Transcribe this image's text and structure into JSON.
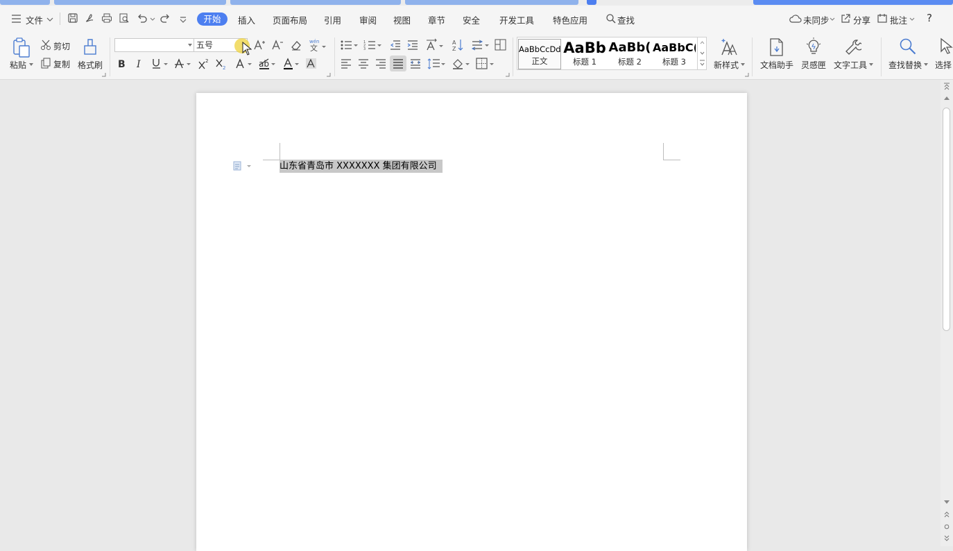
{
  "menubar": {
    "file_label": "文件",
    "tabs": [
      {
        "label": "开始",
        "active": true
      },
      {
        "label": "插入"
      },
      {
        "label": "页面布局"
      },
      {
        "label": "引用"
      },
      {
        "label": "审阅"
      },
      {
        "label": "视图"
      },
      {
        "label": "章节"
      },
      {
        "label": "安全"
      },
      {
        "label": "开发工具"
      },
      {
        "label": "特色应用"
      }
    ],
    "search_label": "查找",
    "sync_label": "未同步",
    "share_label": "分享",
    "comment_label": "批注",
    "help_label": "?"
  },
  "ribbon": {
    "paste_label": "粘贴",
    "cut_label": "剪切",
    "copy_label": "复制",
    "format_painter_label": "格式刷",
    "font_name": "",
    "font_size": "五号",
    "styles": [
      {
        "sample": "AaBbCcDd",
        "name": "正文"
      },
      {
        "sample": "AaBb",
        "name": "标题 1"
      },
      {
        "sample": "AaBb(",
        "name": "标题 2"
      },
      {
        "sample": "AaBbC(",
        "name": "标题 3"
      }
    ],
    "new_style_label": "新样式",
    "doc_assistant_label": "文档助手",
    "inspiration_label": "灵感匣",
    "text_tools_label": "文字工具",
    "find_replace_label": "查找替换",
    "select_label": "选择"
  },
  "document": {
    "line_text": "山东省青岛市 XXXXXXX 集团有限公司"
  },
  "colors": {
    "accent": "#4d7ff0",
    "selection": "#c8c8c8"
  }
}
